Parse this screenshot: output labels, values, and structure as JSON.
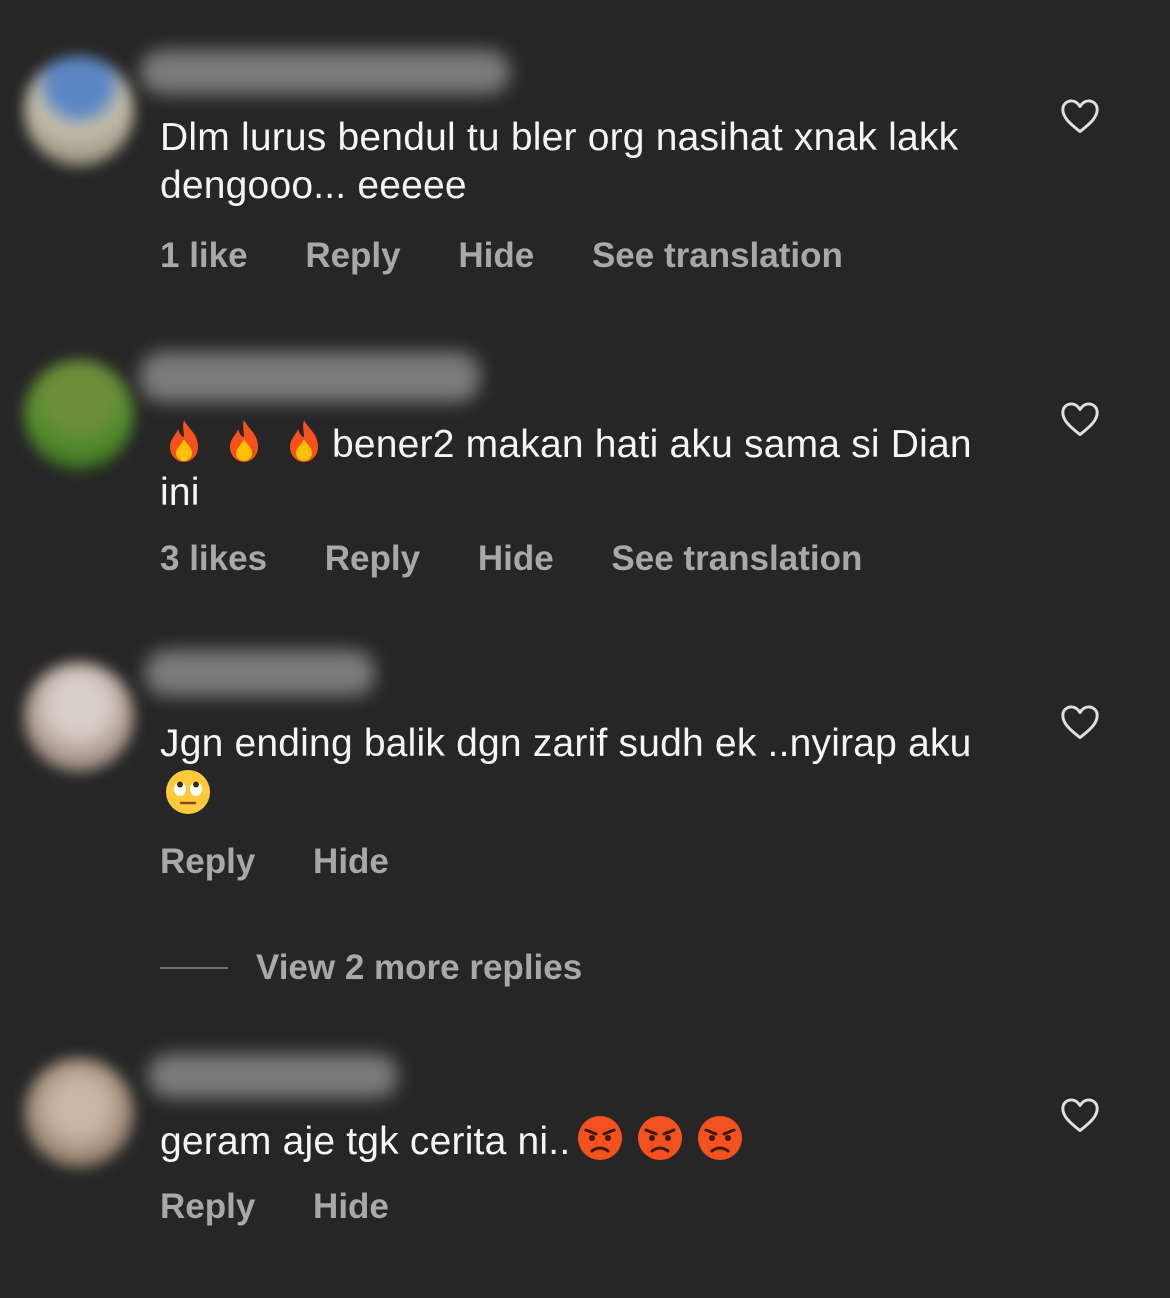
{
  "comments": [
    {
      "text": "Dlm lurus bendul tu bler org nasihat xnak lakk dengooo... eeeee",
      "likes": "1 like",
      "reply": "Reply",
      "hide": "Hide",
      "translate": "See translation"
    },
    {
      "prefix_emoji": [
        "fire-emoji",
        "fire-emoji",
        "fire-emoji"
      ],
      "text": "bener2 makan hati aku sama si Dian ini",
      "likes": "3 likes",
      "reply": "Reply",
      "hide": "Hide",
      "translate": "See translation"
    },
    {
      "text": "Jgn ending balik dgn zarif sudh ek ..nyirap aku",
      "suffix_emoji": [
        "eye-roll-emoji"
      ],
      "reply": "Reply",
      "hide": "Hide",
      "more_replies": "View 2 more replies"
    },
    {
      "text": "geram aje tgk cerita ni..",
      "suffix_emoji": [
        "angry-emoji",
        "angry-emoji",
        "angry-emoji"
      ],
      "reply": "Reply",
      "hide": "Hide"
    }
  ],
  "colors": {
    "background": "#262626",
    "text": "#f5f5f5",
    "secondary": "#a8a8a8"
  },
  "icons": {
    "like": "heart-outline-icon"
  }
}
